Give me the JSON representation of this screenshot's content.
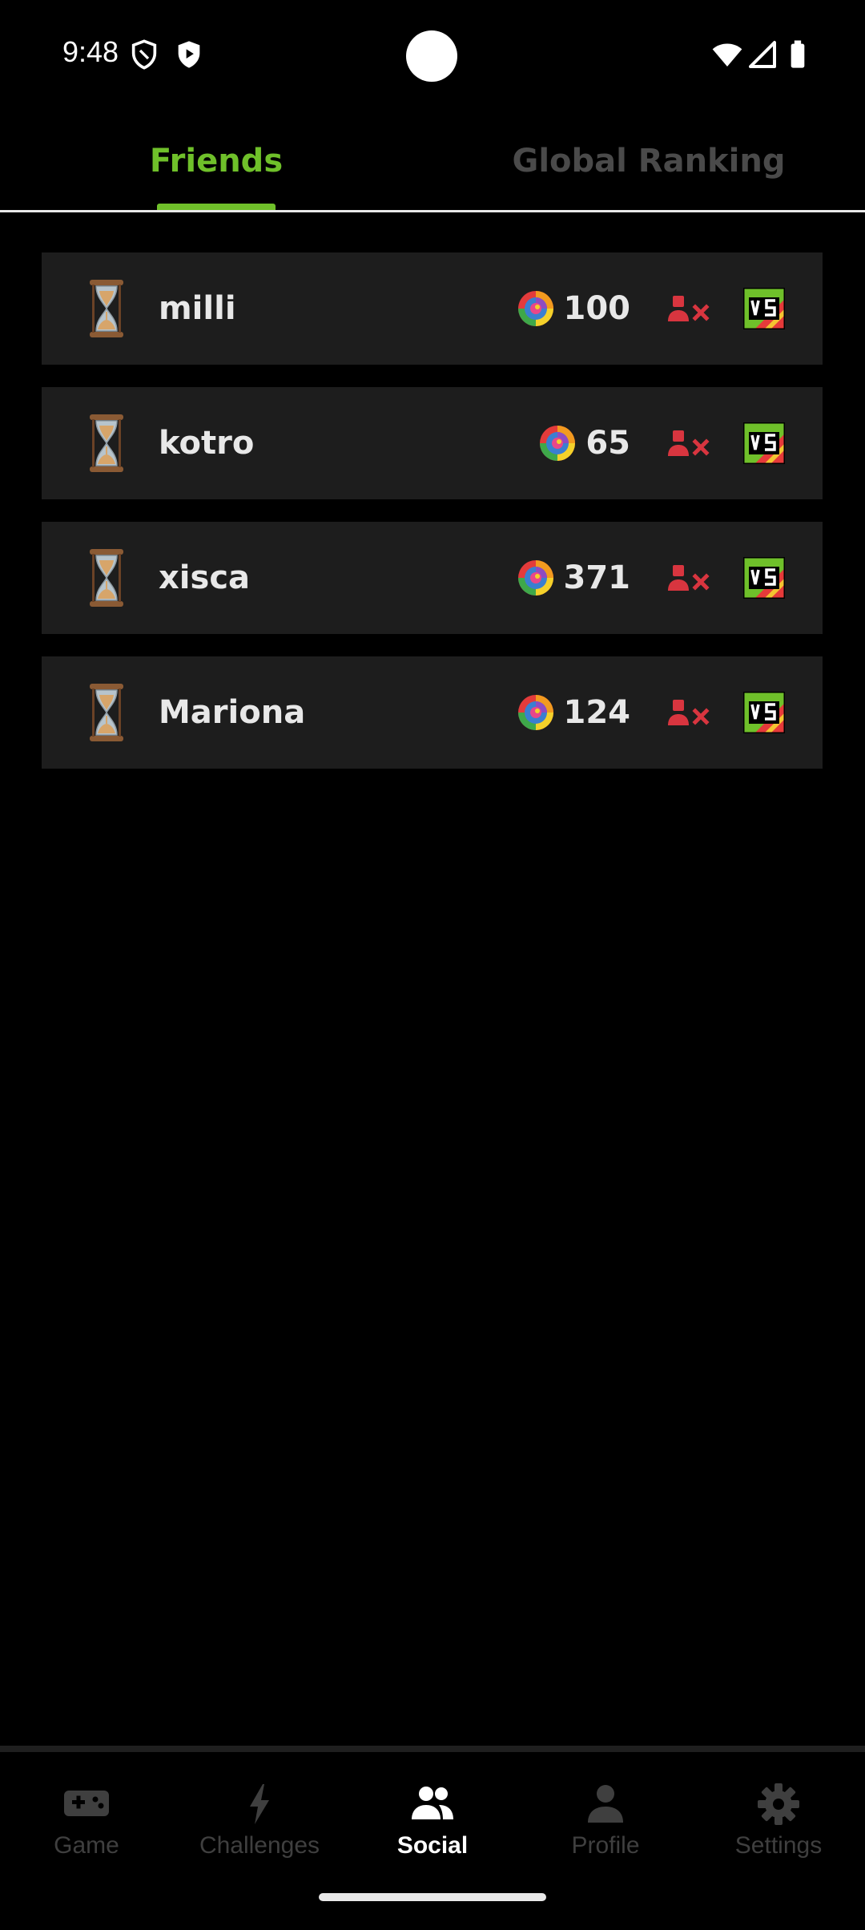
{
  "status_bar": {
    "time": "9:48",
    "icons": [
      "shield-outline-icon",
      "play-shield-icon",
      "wifi-icon",
      "signal-icon",
      "battery-icon"
    ]
  },
  "tabs": [
    {
      "label": "Friends",
      "active": true
    },
    {
      "label": "Global Ranking",
      "active": false
    }
  ],
  "colors": {
    "accent": "#6fc02a",
    "row_bg": "#1d1d1d",
    "inactive": "#3f3f3f",
    "remove_red": "#d8353f"
  },
  "friends": [
    {
      "name": "milli",
      "score": "100"
    },
    {
      "name": "kotro",
      "score": "65"
    },
    {
      "name": "xisca",
      "score": "371"
    },
    {
      "name": "Mariona",
      "score": "124"
    }
  ],
  "nav": [
    {
      "label": "Game",
      "icon": "gamepad-icon"
    },
    {
      "label": "Challenges",
      "icon": "lightning-icon"
    },
    {
      "label": "Social",
      "icon": "people-icon",
      "active": true
    },
    {
      "label": "Profile",
      "icon": "person-icon"
    },
    {
      "label": "Settings",
      "icon": "gear-icon"
    }
  ]
}
